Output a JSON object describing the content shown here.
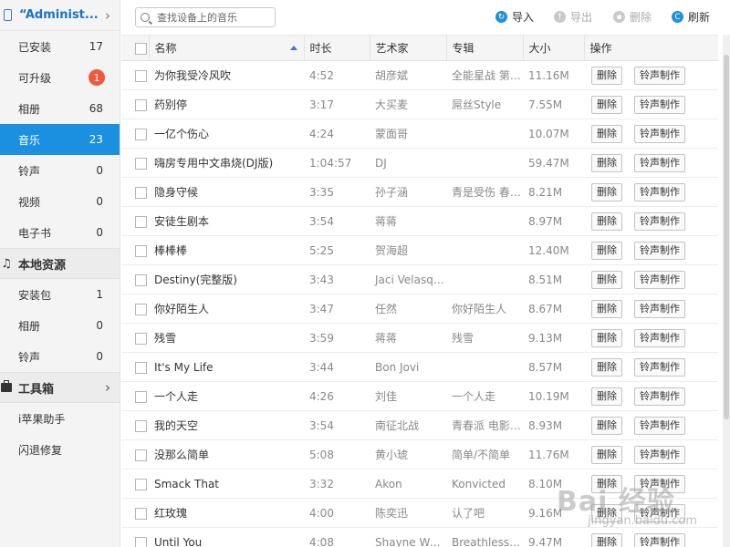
{
  "sidebar": {
    "device_name": "“Administ...",
    "items": [
      {
        "label": "已安装",
        "count": "17"
      },
      {
        "label": "可升级",
        "badge": "1"
      },
      {
        "label": "相册",
        "count": "68"
      },
      {
        "label": "音乐",
        "count": "23",
        "active": true
      },
      {
        "label": "铃声",
        "count": "0"
      },
      {
        "label": "视频",
        "count": "0"
      },
      {
        "label": "电子书",
        "count": "0"
      }
    ],
    "local": {
      "title": "本地资源",
      "items": [
        {
          "label": "安装包",
          "count": "1"
        },
        {
          "label": "相册",
          "count": "0"
        },
        {
          "label": "铃声",
          "count": "0"
        }
      ]
    },
    "toolbox": {
      "title": "工具箱",
      "items": [
        {
          "label": "i苹果助手"
        },
        {
          "label": "闪退修复"
        }
      ]
    }
  },
  "toolbar": {
    "search_placeholder": "查找设备上的音乐",
    "import_label": "导入",
    "export_label": "导出",
    "delete_label": "删除",
    "refresh_label": "刷新"
  },
  "table": {
    "headers": {
      "name": "名称",
      "duration": "时长",
      "artist": "艺术家",
      "album": "专辑",
      "size": "大小",
      "ops": "操作"
    },
    "delete_btn": "删除",
    "ringtone_btn": "铃声制作",
    "rows": [
      {
        "name": "为你我受冷风吹",
        "duration": "4:52",
        "artist": "胡彦斌",
        "album": "全能星战 第十...",
        "size": "11.16M"
      },
      {
        "name": "药别停",
        "duration": "3:17",
        "artist": "大买麦",
        "album": "屌丝Style",
        "size": "7.55M"
      },
      {
        "name": "一亿个伤心",
        "duration": "4:24",
        "artist": "蒙面哥",
        "album": "",
        "size": "10.07M"
      },
      {
        "name": "嗨房专用中文串烧(DJ版)",
        "duration": "1:04:57",
        "artist": "DJ",
        "album": "",
        "size": "59.47M"
      },
      {
        "name": "隐身守候",
        "duration": "3:35",
        "artist": "孙子涵",
        "album": "青是受伤 春是...",
        "size": "8.21M"
      },
      {
        "name": "安徒生剧本",
        "duration": "3:54",
        "artist": "蒋蒋",
        "album": "",
        "size": "8.97M"
      },
      {
        "name": "棒棒棒",
        "duration": "5:25",
        "artist": "贺海超",
        "album": "",
        "size": "12.40M"
      },
      {
        "name": "Destiny(完整版)",
        "duration": "3:43",
        "artist": "Jaci Velasquez",
        "album": "",
        "size": "8.51M"
      },
      {
        "name": "你好陌生人",
        "duration": "3:47",
        "artist": "任然",
        "album": "你好陌生人",
        "size": "8.67M"
      },
      {
        "name": "残雪",
        "duration": "3:59",
        "artist": "蒋蒋",
        "album": "残雪",
        "size": "9.13M"
      },
      {
        "name": "It's My Life",
        "duration": "3:44",
        "artist": "Bon Jovi",
        "album": "",
        "size": "8.57M"
      },
      {
        "name": "一个人走",
        "duration": "4:26",
        "artist": "刘佳",
        "album": "一个人走",
        "size": "10.19M"
      },
      {
        "name": "我的天空",
        "duration": "3:54",
        "artist": "南征北战",
        "album": "青春派 电影原声",
        "size": "8.93M"
      },
      {
        "name": "没那么简单",
        "duration": "5:08",
        "artist": "黄小琥",
        "album": "简单/不简单",
        "size": "11.76M"
      },
      {
        "name": "Smack That",
        "duration": "3:32",
        "artist": "Akon",
        "album": "Konvicted",
        "size": "8.10M"
      },
      {
        "name": "红玫瑰",
        "duration": "4:00",
        "artist": "陈奕迅",
        "album": "认了吧",
        "size": "9.16M"
      },
      {
        "name": "Until You",
        "duration": "4:08",
        "artist": "Shayne Ward",
        "album": "Breathless(Sp...",
        "size": "9.47M"
      }
    ]
  },
  "watermark": {
    "text": "Bai 经验",
    "sub": "jingyan.baidu.com"
  }
}
